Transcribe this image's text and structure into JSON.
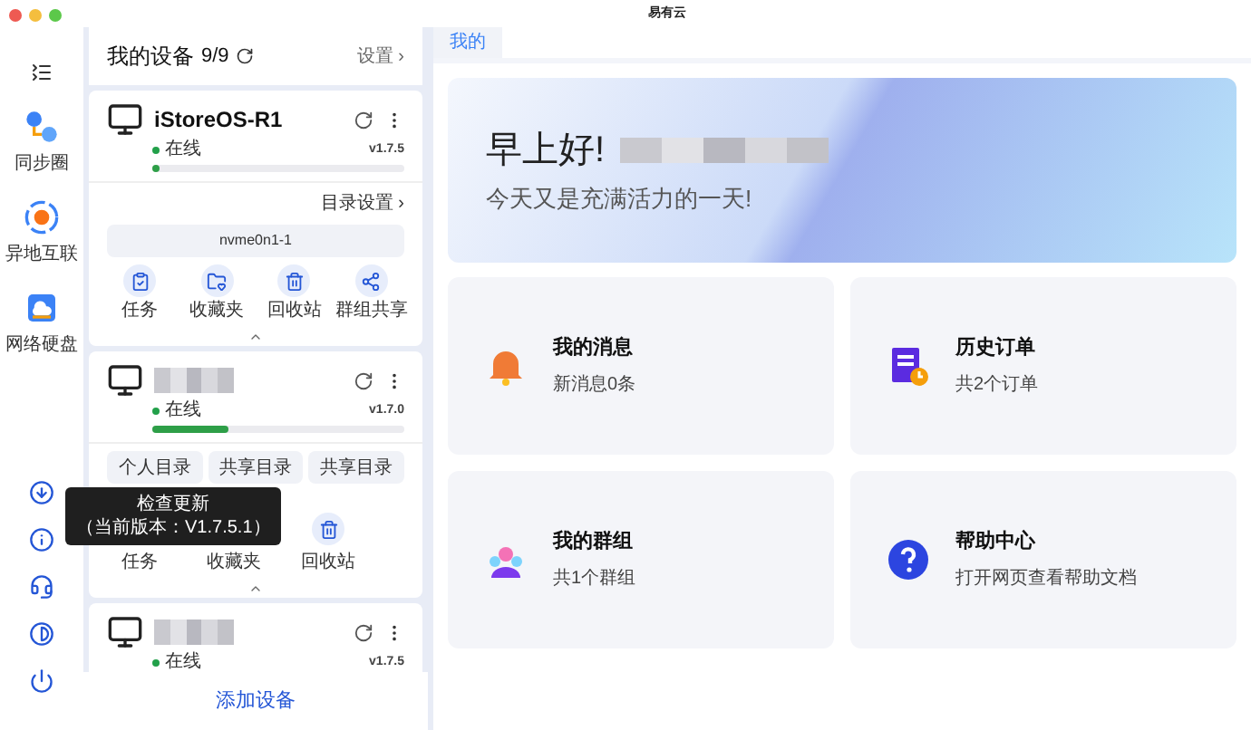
{
  "window": {
    "title": "易有云"
  },
  "nav": {
    "items": [
      {
        "label": "同步圈"
      },
      {
        "label": "异地互联"
      },
      {
        "label": "网络硬盘"
      }
    ]
  },
  "tooltip": {
    "title": "检查更新",
    "subtitle": "（当前版本：V1.7.5.1）"
  },
  "devices_header": {
    "title": "我的设备",
    "count": "9/9",
    "settings": "设置 ›"
  },
  "devices": [
    {
      "name": "iStoreOS-R1",
      "status": "在线",
      "version": "v1.7.5",
      "level": 0.02,
      "expanded": true,
      "panel": {
        "kind": "folder",
        "settings_link": "目录设置 ›",
        "folder": "nvme0n1-1",
        "actions": [
          "任务",
          "收藏夹",
          "回收站",
          "群组共享"
        ]
      }
    },
    {
      "status": "在线",
      "version": "v1.7.0",
      "level": 0.3,
      "expanded": true,
      "panel": {
        "kind": "tabs",
        "tabs": [
          "个人目录",
          "共享目录",
          "共享目录"
        ],
        "actions": [
          "任务",
          "收藏夹",
          "回收站"
        ]
      }
    },
    {
      "status": "在线",
      "version": "v1.7.5"
    }
  ],
  "add_device": "添加设备",
  "tabs": [
    {
      "label": "我的",
      "selected": true
    }
  ],
  "banner": {
    "greeting": "早上好!",
    "subtitle": "今天又是充满活力的一天!"
  },
  "cards": [
    {
      "title": "我的消息",
      "subtitle": "新消息0条"
    },
    {
      "title": "历史订单",
      "subtitle": "共2个订单"
    },
    {
      "title": "我的群组",
      "subtitle": "共1个群组"
    },
    {
      "title": "帮助中心",
      "subtitle": "打开网页查看帮助文档"
    }
  ]
}
